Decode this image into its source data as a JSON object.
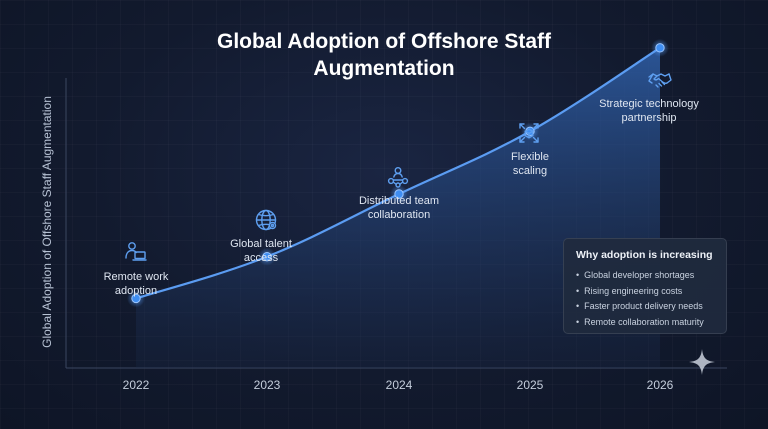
{
  "chart_data": {
    "type": "area",
    "title": "Global Adoption of Offshore Staff Augmentation",
    "title_lines": [
      "Global Adoption of Offshore Staff",
      "Augmentation"
    ],
    "ylabel": "Global Adoption of Offshore Staff Augmentation",
    "xlabel": "",
    "x": [
      "2022",
      "2023",
      "2024",
      "2025",
      "2026"
    ],
    "values": [
      1.0,
      1.6,
      2.5,
      3.4,
      4.6
    ],
    "ylim": [
      0,
      5
    ],
    "grid": false,
    "colors": {
      "line": "#5b9cf2",
      "point": "#3f8ef2",
      "fill_top": "#2f5fa8"
    },
    "annotations": [
      {
        "lines": [
          "Remote work",
          "adoption"
        ],
        "icon": "person-laptop-icon"
      },
      {
        "lines": [
          "Global talent",
          "access"
        ],
        "icon": "globe-network-icon"
      },
      {
        "lines": [
          "Distributed team",
          "collaboration"
        ],
        "icon": "team-network-icon"
      },
      {
        "lines": [
          "Flexible",
          "scaling"
        ],
        "icon": "scaling-cube-icon"
      },
      {
        "lines": [
          "Strategic technology",
          "partnership"
        ],
        "icon": "handshake-icon"
      }
    ]
  },
  "info_box": {
    "title": "Why adoption is increasing",
    "items": [
      "Global developer shortages",
      "Rising engineering costs",
      "Faster product delivery needs",
      "Remote collaboration maturity"
    ]
  },
  "icons": {
    "corner": "sparkle-icon"
  }
}
